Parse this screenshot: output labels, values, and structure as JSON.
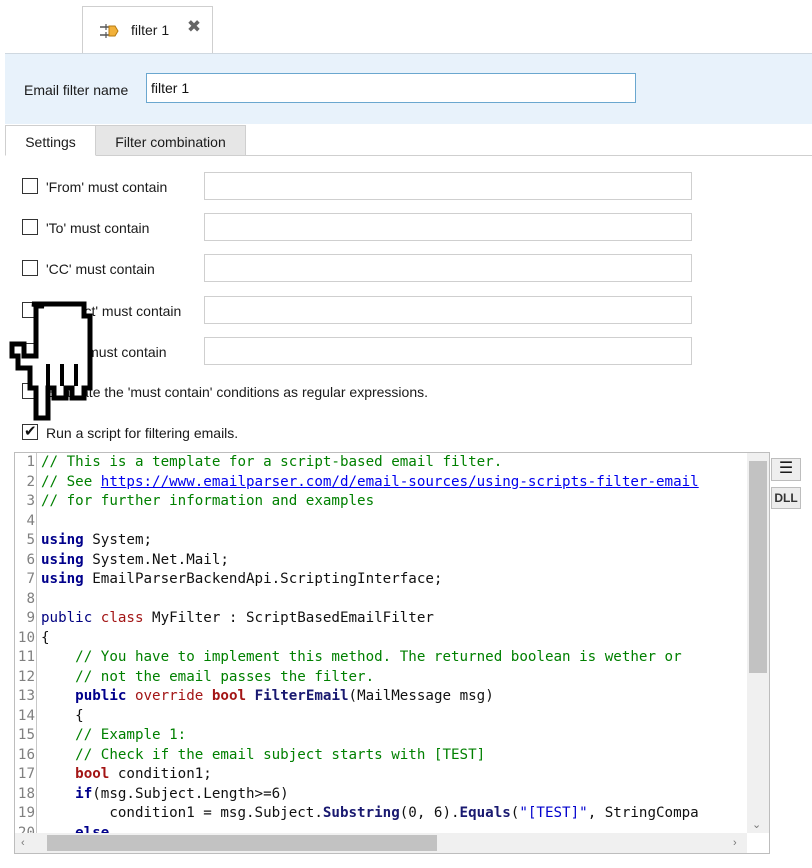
{
  "doc_tab": {
    "label": "filter 1",
    "close_glyph": "✖",
    "icon": "filter-arrows-icon"
  },
  "filter_name": {
    "label": "Email filter name",
    "value": "filter 1"
  },
  "tabs": [
    {
      "label": "Settings",
      "active": true
    },
    {
      "label": "Filter combination",
      "active": false
    }
  ],
  "conditions": [
    {
      "label": "'From' must contain",
      "checked": false,
      "value": ""
    },
    {
      "label": "'To' must contain",
      "checked": false,
      "value": ""
    },
    {
      "label": "'CC' must contain",
      "checked": false,
      "value": ""
    },
    {
      "label": "'Subject' must contain",
      "checked": false,
      "value": ""
    },
    {
      "label": "'Body' must contain",
      "checked": false,
      "value": ""
    }
  ],
  "regex_option": {
    "label": "Evaluate the 'must contain' conditions as regular expressions.",
    "checked": false
  },
  "script_option": {
    "label": "Run a script for filtering emails.",
    "checked": true
  },
  "code_lines": [
    "// This is a template for a script-based email filter.",
    "// See https://www.emailparser.com/d/email-sources/using-scripts-filter-email",
    "// for further information and examples",
    "",
    "using System;",
    "using System.Net.Mail;",
    "using EmailParserBackendApi.ScriptingInterface;",
    "",
    "public class MyFilter : ScriptBasedEmailFilter",
    "{",
    "    // You have to implement this method. The returned boolean is wether or",
    "    // not the email passes the filter.",
    "    public override bool FilterEmail(MailMessage msg)",
    "    {",
    "    // Example 1:",
    "    // Check if the email subject starts with [TEST]",
    "    bool condition1;",
    "    if(msg.Subject.Length>=6)",
    "        condition1 = msg.Subject.Substring(0, 6).Equals(\"[TEST]\", StringCompa",
    "    else"
  ],
  "side_buttons": {
    "menu_glyph": "☰",
    "dll_label": "DLL"
  },
  "colors": {
    "header_bg": "#e8f2fb",
    "input_focus_border": "#6aa7cf",
    "comment": "#008000",
    "keyword": "#00008b",
    "modifier": "#a31515",
    "string": "#0000cd"
  }
}
